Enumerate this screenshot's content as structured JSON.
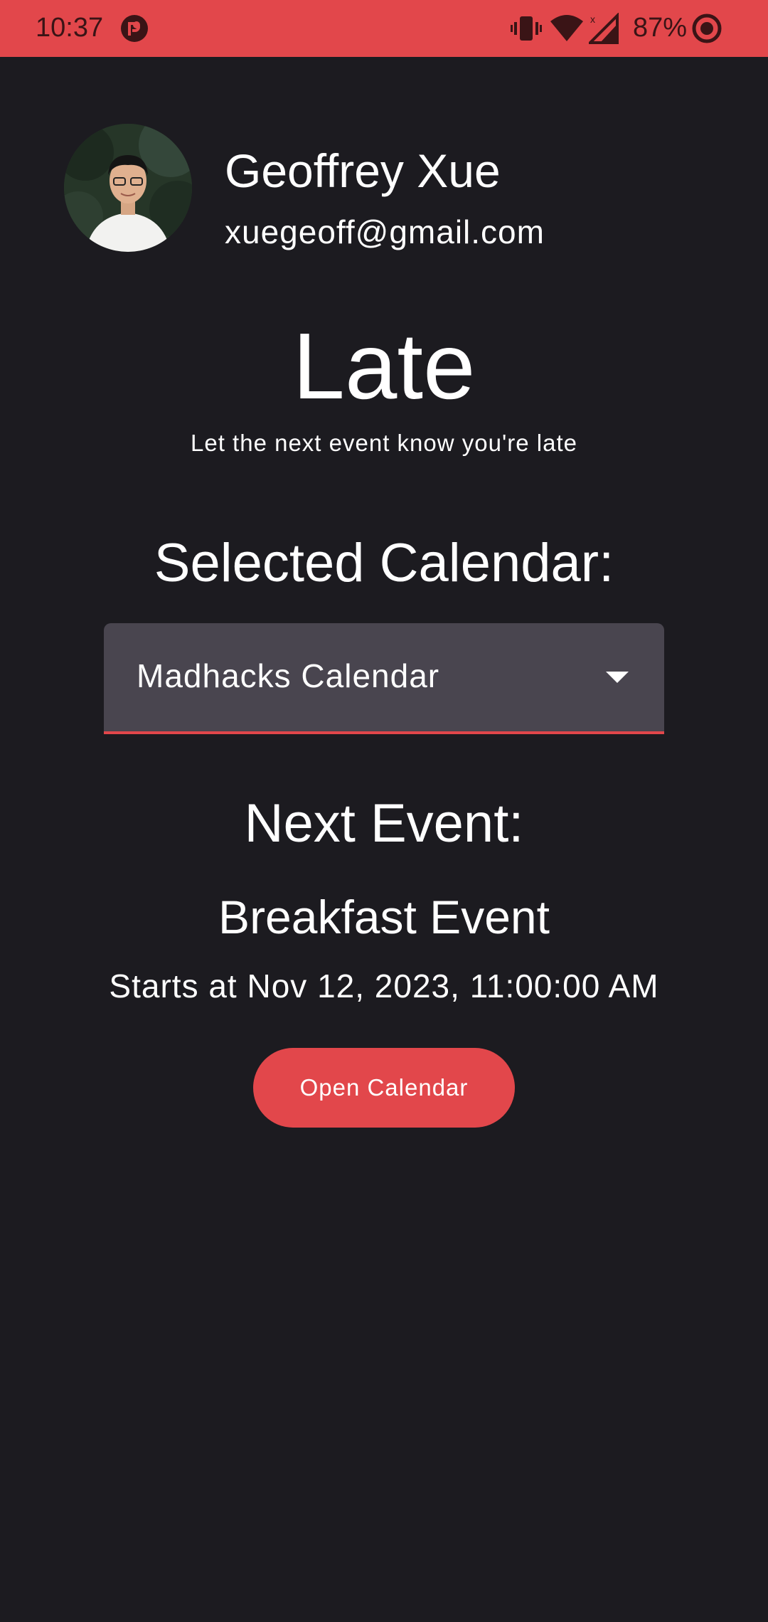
{
  "status_bar": {
    "time": "10:37",
    "battery": "87%",
    "icons": [
      "app-notification-icon",
      "vibrate-icon",
      "wifi-icon",
      "signal-icon",
      "battery-saver-icon"
    ]
  },
  "colors": {
    "accent": "#e2474b",
    "background": "#1c1b20",
    "dropdown_bg": "#49454f",
    "text": "#ffffff"
  },
  "profile": {
    "name": "Geoffrey Xue",
    "email": "xuegeoff@gmail.com"
  },
  "app": {
    "title": "Late",
    "subtitle": "Let the next event know you're late"
  },
  "calendar": {
    "heading": "Selected Calendar:",
    "selected": "Madhacks Calendar"
  },
  "next_event": {
    "heading": "Next Event:",
    "name": "Breakfast Event",
    "time": "Starts at Nov 12, 2023, 11:00:00 AM",
    "button_label": "Open Calendar"
  }
}
